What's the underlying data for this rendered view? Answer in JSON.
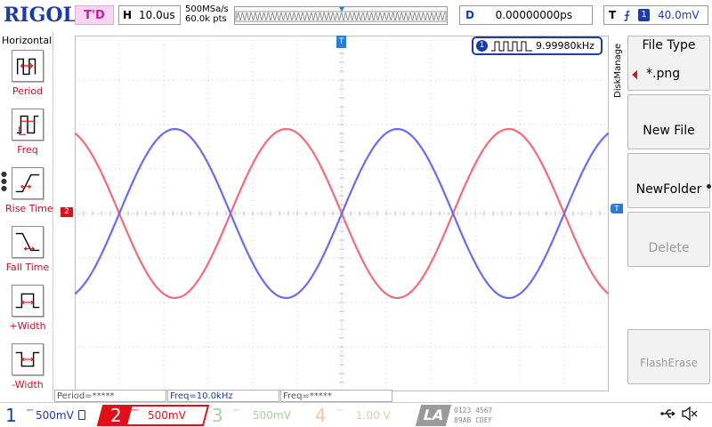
{
  "header": {
    "logo": "RIGOL",
    "trigger_status": "T'D",
    "horizontal_label": "H",
    "horizontal_scale": "10.0us",
    "sample_rate": "500MSa/s",
    "memory_depth": "60.0k pts",
    "delay_label": "D",
    "delay_value": "0.00000000ps",
    "trigger_label": "T",
    "trigger_source": "1",
    "trigger_level": "40.0mV"
  },
  "left_menu": {
    "title": "Horizontal",
    "items": [
      {
        "label": "Period",
        "icon": "period-icon"
      },
      {
        "label": "Freq",
        "icon": "freq-icon"
      },
      {
        "label": "Rise Time",
        "icon": "rise-time-icon"
      },
      {
        "label": "Fall Time",
        "icon": "fall-time-icon"
      },
      {
        "label": "+Width",
        "icon": "positive-width-icon"
      },
      {
        "label": "-Width",
        "icon": "negative-width-icon"
      }
    ]
  },
  "screen": {
    "freq_counter_channel": "1",
    "freq_counter_value": "9.99980kHz",
    "ch2_marker": "2",
    "trigger_level_marker": "T",
    "trigger_position_marker": "T"
  },
  "right_menu": {
    "group_label": "DiskManage",
    "file_type_title": "File Type",
    "file_type_value": "*.png",
    "new_file": "New File",
    "new_folder": "NewFolder",
    "delete": "Delete",
    "flash_erase": "FlashErase"
  },
  "measurements": [
    "Period=*****",
    "Freq=10.0kHz",
    "Freq=*****"
  ],
  "channels": [
    {
      "num": "1",
      "scale": "500mV",
      "color": "#1c3aa8"
    },
    {
      "num": "2",
      "scale": "500mV",
      "color": "#e0101a"
    },
    {
      "num": "3",
      "scale": "500mV",
      "color": "#a8d0a0"
    },
    {
      "num": "4",
      "scale": "1.00 V",
      "color": "#e8c8a8"
    }
  ],
  "la": {
    "label": "LA",
    "digits_top": "0123 4567",
    "digits_mid": "89AB CDEF",
    "digits_bot": "0123 4567",
    "digits_rt": "89AB CDEF"
  },
  "colors": {
    "ch1_trace": "#6a6af0",
    "ch2_trace": "#f06a78",
    "grid": "#c8c8c8",
    "accent": "#1c3aa8"
  },
  "status_icons": [
    "usb-icon",
    "speaker-muted-icon"
  ]
}
